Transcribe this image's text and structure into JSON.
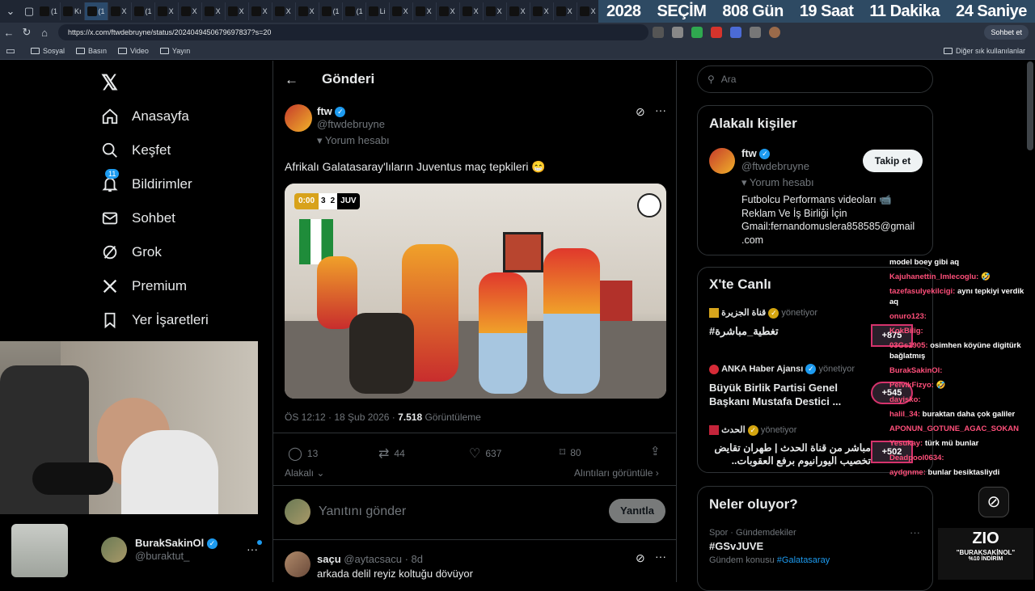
{
  "browser": {
    "tabs": [
      {
        "label": "(1",
        "active": false
      },
      {
        "label": "Kı",
        "active": false
      },
      {
        "label": "(1",
        "active": true
      },
      {
        "label": "X",
        "active": false
      },
      {
        "label": "(1",
        "active": false
      },
      {
        "label": "X",
        "active": false
      },
      {
        "label": "X",
        "active": false
      },
      {
        "label": "X",
        "active": false
      },
      {
        "label": "X",
        "active": false
      },
      {
        "label": "X",
        "active": false
      },
      {
        "label": "X",
        "active": false
      },
      {
        "label": "X",
        "active": false
      },
      {
        "label": "(1",
        "active": false
      },
      {
        "label": "(1",
        "active": false
      },
      {
        "label": "Li",
        "active": false
      },
      {
        "label": "X",
        "active": false
      },
      {
        "label": "X",
        "active": false
      },
      {
        "label": "X",
        "active": false
      },
      {
        "label": "X",
        "active": false
      },
      {
        "label": "X",
        "active": false
      },
      {
        "label": "X",
        "active": false
      },
      {
        "label": "X",
        "active": false
      },
      {
        "label": "X",
        "active": false
      },
      {
        "label": "X",
        "active": false
      }
    ],
    "countdown": [
      "2028",
      "SEÇİM",
      "808 Gün",
      "19 Saat",
      "11 Dakika",
      "24 Saniye"
    ],
    "url": "https://x.com/ftwdebruyne/status/2024049450679697837?s=20",
    "chat_button": "Sohbet et",
    "bookmarks": [
      "Sosyal",
      "Basın",
      "Video",
      "Yayın"
    ],
    "other_bookmarks": "Diğer sık kullanılanlar"
  },
  "sidebar": {
    "items": [
      {
        "label": "Anasayfa",
        "icon": "home-icon"
      },
      {
        "label": "Keşfet",
        "icon": "search-icon"
      },
      {
        "label": "Bildirimler",
        "icon": "bell-icon"
      },
      {
        "label": "Sohbet",
        "icon": "mail-icon"
      },
      {
        "label": "Grok",
        "icon": "grok-icon"
      },
      {
        "label": "Premium",
        "icon": "x-icon"
      },
      {
        "label": "Yer İşaretleri",
        "icon": "bookmark-icon"
      }
    ],
    "notification_badge": "11",
    "account": {
      "name": "BurakSakinOl",
      "handle": "@buraktut_"
    }
  },
  "main": {
    "header_title": "Gönderi",
    "post": {
      "name": "ftw",
      "handle": "@ftwdebruyne",
      "label": "Yorum hesabı",
      "text": "Afrikalı Galatasaray'lıların Juventus maç tepkileri 😁",
      "video_score": {
        "time": "0:00",
        "home": "3",
        "away": "2",
        "team": "JUV"
      },
      "meta_time": "ÖS 12:12 · 18 Şub 2026 · ",
      "meta_views": "7.518",
      "meta_views_label": " Görüntüleme",
      "stats": {
        "replies": "13",
        "reposts": "44",
        "likes": "637",
        "bookmarks": "80"
      },
      "relevant": "Alakalı",
      "quotes": "Alıntıları görüntüle"
    },
    "reply_placeholder": "Yanıtını gönder",
    "reply_button": "Yanıtla",
    "reply_post": {
      "name": "saçu",
      "handle": "@aytacsacu · 8d",
      "text": "arkada delil reyiz koltuğu dövüyor"
    }
  },
  "right": {
    "search_placeholder": "Ara",
    "related": {
      "title": "Alakalı kişiler",
      "name": "ftw",
      "handle": "@ftwdebruyne",
      "label": "Yorum hesabı",
      "follow": "Takip et",
      "bio": [
        "Futbolcu Performans videoları 📹",
        "Reklam Ve İş Birliği İçin",
        "Gmail:fernandomuslera858585@gmail",
        ".com"
      ]
    },
    "live": {
      "title": "X'te Canlı",
      "items": [
        {
          "host": "قناة الجزيرة",
          "role": "yönetiyor",
          "title": "#تغطية_مباشرة",
          "count": ""
        },
        {
          "host": "ANKA Haber Ajansı",
          "role": "yönetiyor",
          "title": "Büyük Birlik Partisi Genel Başkanı Mustafa Destici ...",
          "count": "+545"
        },
        {
          "host": "الحدث",
          "role": "yönetiyor",
          "title": "مباشر من قناة الحدث | طهران تقايض تخصيب اليورانيوم برفع العقوبات..",
          "count": "+502"
        }
      ],
      "first_count": "+875"
    },
    "trends": {
      "title": "Neler oluyor?",
      "category": "Spor · Gündemdekiler",
      "tag": "#GSvJUVE",
      "topic_label": "Gündem konusu",
      "topic": "#Galatasaray"
    }
  },
  "chat": [
    {
      "user": "",
      "text": "model boey gibi aq"
    },
    {
      "user": "Kajuhanettin_Imlecoglu:",
      "text": "🤣"
    },
    {
      "user": "tazefasulyekilcigi:",
      "text": "aynı tepkiyi verdik aq"
    },
    {
      "user": "onuro123:",
      "text": ""
    },
    {
      "user": "KokBilig:",
      "text": ""
    },
    {
      "user": "03Gs1905:",
      "text": "osimhen köyüne digitürk bağlatmış"
    },
    {
      "user": "BurakSakinOl:",
      "text": ""
    },
    {
      "user": "PelvikFizyo:",
      "text": "🤣"
    },
    {
      "user": "dayisko:",
      "text": ""
    },
    {
      "user": "halil_34:",
      "text": "buraktan daha çok galiler"
    },
    {
      "user": "APONUN_GOTUNE_AGAC_SOKAN",
      "text": ""
    },
    {
      "user": "Yesukay:",
      "text": "türk mü bunlar"
    },
    {
      "user": "Deadpool0634:",
      "text": ""
    },
    {
      "user": "aydgnme:",
      "text": "bunlar besiktasliydi"
    }
  ],
  "overlay": {
    "brand": "ZIO",
    "promo": "\"BURAKSAKİNOL\"",
    "discount": "%10 İNDİRİM"
  }
}
